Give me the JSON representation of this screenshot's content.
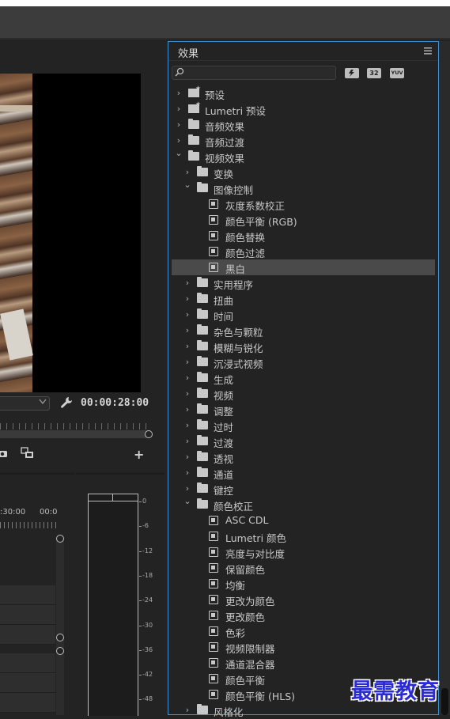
{
  "effects_panel": {
    "title": "效果",
    "search": {
      "placeholder": "",
      "value": ""
    },
    "filter_buttons": [
      {
        "icon": "accelerated-effects-icon",
        "label": ""
      },
      {
        "icon": "32bit-color-icon",
        "label": "32"
      },
      {
        "icon": "yuv-effects-icon",
        "label": "YUV"
      }
    ],
    "tree": [
      {
        "label": "预设",
        "depth": 0,
        "type": "preset-folder",
        "expanded": false
      },
      {
        "label": "Lumetri 预设",
        "depth": 0,
        "type": "preset-folder",
        "expanded": false
      },
      {
        "label": "音频效果",
        "depth": 0,
        "type": "folder",
        "expanded": false
      },
      {
        "label": "音频过渡",
        "depth": 0,
        "type": "folder",
        "expanded": false
      },
      {
        "label": "视频效果",
        "depth": 0,
        "type": "folder",
        "expanded": true
      },
      {
        "label": "变换",
        "depth": 1,
        "type": "folder",
        "expanded": false
      },
      {
        "label": "图像控制",
        "depth": 1,
        "type": "folder",
        "expanded": true
      },
      {
        "label": "灰度系数校正",
        "depth": 2,
        "type": "effect"
      },
      {
        "label": "颜色平衡 (RGB)",
        "depth": 2,
        "type": "effect"
      },
      {
        "label": "颜色替换",
        "depth": 2,
        "type": "effect"
      },
      {
        "label": "颜色过滤",
        "depth": 2,
        "type": "effect"
      },
      {
        "label": "黑白",
        "depth": 2,
        "type": "effect",
        "selected": true
      },
      {
        "label": "实用程序",
        "depth": 1,
        "type": "folder",
        "expanded": false
      },
      {
        "label": "扭曲",
        "depth": 1,
        "type": "folder",
        "expanded": false
      },
      {
        "label": "时间",
        "depth": 1,
        "type": "folder",
        "expanded": false
      },
      {
        "label": "杂色与颗粒",
        "depth": 1,
        "type": "folder",
        "expanded": false
      },
      {
        "label": "模糊与锐化",
        "depth": 1,
        "type": "folder",
        "expanded": false
      },
      {
        "label": "沉浸式视频",
        "depth": 1,
        "type": "folder",
        "expanded": false
      },
      {
        "label": "生成",
        "depth": 1,
        "type": "folder",
        "expanded": false
      },
      {
        "label": "视频",
        "depth": 1,
        "type": "folder",
        "expanded": false
      },
      {
        "label": "调整",
        "depth": 1,
        "type": "folder",
        "expanded": false
      },
      {
        "label": "过时",
        "depth": 1,
        "type": "folder",
        "expanded": false
      },
      {
        "label": "过渡",
        "depth": 1,
        "type": "folder",
        "expanded": false
      },
      {
        "label": "透视",
        "depth": 1,
        "type": "folder",
        "expanded": false
      },
      {
        "label": "通道",
        "depth": 1,
        "type": "folder",
        "expanded": false
      },
      {
        "label": "键控",
        "depth": 1,
        "type": "folder",
        "expanded": false
      },
      {
        "label": "颜色校正",
        "depth": 1,
        "type": "folder",
        "expanded": true
      },
      {
        "label": "ASC CDL",
        "depth": 2,
        "type": "effect"
      },
      {
        "label": "Lumetri 颜色",
        "depth": 2,
        "type": "effect"
      },
      {
        "label": "亮度与对比度",
        "depth": 2,
        "type": "effect"
      },
      {
        "label": "保留颜色",
        "depth": 2,
        "type": "effect"
      },
      {
        "label": "均衡",
        "depth": 2,
        "type": "effect"
      },
      {
        "label": "更改为颜色",
        "depth": 2,
        "type": "effect"
      },
      {
        "label": "更改颜色",
        "depth": 2,
        "type": "effect"
      },
      {
        "label": "色彩",
        "depth": 2,
        "type": "effect"
      },
      {
        "label": "视频限制器",
        "depth": 2,
        "type": "effect"
      },
      {
        "label": "通道混合器",
        "depth": 2,
        "type": "effect"
      },
      {
        "label": "颜色平衡",
        "depth": 2,
        "type": "effect"
      },
      {
        "label": "颜色平衡 (HLS)",
        "depth": 2,
        "type": "effect"
      },
      {
        "label": "风格化",
        "depth": 1,
        "type": "folder",
        "expanded": false
      }
    ]
  },
  "program_monitor": {
    "timecode": "00:00:28:00",
    "fit_value": ""
  },
  "timeline": {
    "ruler_labels": [
      ":30:00",
      "00:0"
    ]
  },
  "audio_meter": {
    "scale": [
      "0",
      "-6",
      "-12",
      "-18",
      "-24",
      "-30",
      "-36",
      "-42",
      "-48"
    ]
  },
  "watermark": "最需教育",
  "colors": {
    "panel_bg": "#232323",
    "focus_border": "#3d8fd6",
    "selected_row": "#4a4a4a",
    "text": "#c8c8c8"
  }
}
